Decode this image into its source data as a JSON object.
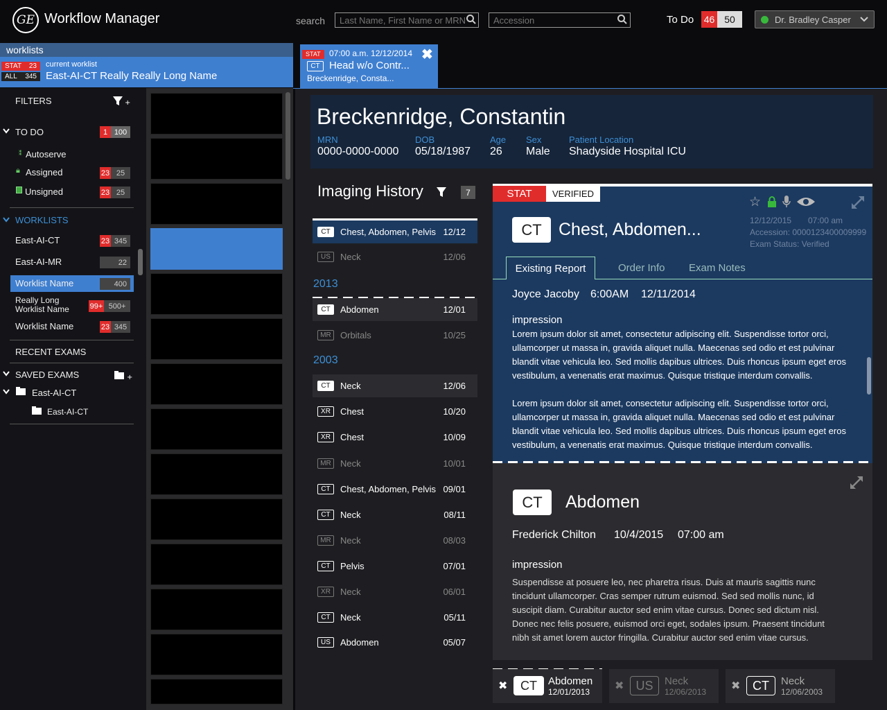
{
  "app": {
    "title": "Workflow Manager",
    "logo": "GE"
  },
  "search": {
    "label": "search",
    "name_placeholder": "Last Name, First Name or MRN",
    "accession_placeholder": "Accession"
  },
  "todo": {
    "label": "To Do",
    "stat": "46",
    "total": "50"
  },
  "user": {
    "name": "Dr. Bradley Casper",
    "status_color": "#38b93c"
  },
  "worklists": {
    "header": "worklists",
    "current_label": "current worklist",
    "current_name": "East-AI-CT Really Really Long Name",
    "stat_label": "STAT",
    "stat_count": "23",
    "all_label": "ALL",
    "all_count": "345"
  },
  "filters": {
    "title": "FILTERS",
    "todo": {
      "label": "TO DO",
      "stat": "1",
      "count": "100"
    },
    "todo_items": [
      {
        "label": "Autoserve",
        "icon": "autoserve-icon"
      },
      {
        "label": "Assigned",
        "stat": "23",
        "count": "25",
        "icon": "lock-icon"
      },
      {
        "label": "Unsigned",
        "stat": "23",
        "count": "25",
        "icon": "unsigned-icon"
      }
    ],
    "worklists_label": "WORKLISTS",
    "worklist_items": [
      {
        "label": "East-AI-CT",
        "stat": "23",
        "count": "345"
      },
      {
        "label": "East-AI-MR",
        "count": "22"
      },
      {
        "label": "Worklist Name",
        "count": "400"
      },
      {
        "label": "Really Long Worklist Name",
        "stat": "99+",
        "count": "500+"
      },
      {
        "label": "Worklist Name",
        "stat": "23",
        "count": "345"
      }
    ],
    "recent_label": "RECENT EXAMS",
    "saved_label": "SAVED EXAMS",
    "saved_folder": "East-AI-CT",
    "saved_sub": "East-AI-CT"
  },
  "tab": {
    "stat": "STAT",
    "time": "07:00 a.m. 12/12/2014",
    "modality": "CT",
    "title": "Head w/o Contr...",
    "patient": "Breckenridge, Consta..."
  },
  "patient": {
    "name": "Breckenridge, Constantin",
    "mrn_label": "MRN",
    "mrn": "0000-0000-0000",
    "dob_label": "DOB",
    "dob": "05/18/1987",
    "age_label": "Age",
    "age": "26",
    "sex_label": "Sex",
    "sex": "Male",
    "loc_label": "Patient Location",
    "loc": "Shadyside Hospital ICU"
  },
  "history": {
    "title": "Imaging History",
    "count": "7",
    "recent": [
      {
        "mod": "CT",
        "name": "Chest, Abdomen, Pelvis",
        "date": "12/12"
      },
      {
        "mod": "US",
        "name": "Neck",
        "date": "12/06"
      }
    ],
    "year1": "2013",
    "y2013": [
      {
        "mod": "CT",
        "name": "Abdomen",
        "date": "12/01"
      },
      {
        "mod": "MR",
        "name": "Orbitals",
        "date": "10/25"
      }
    ],
    "year2": "2003",
    "y2003": [
      {
        "mod": "CT",
        "name": "Neck",
        "date": "12/06"
      },
      {
        "mod": "XR",
        "name": "Chest",
        "date": "10/20"
      },
      {
        "mod": "XR",
        "name": "Chest",
        "date": "10/09"
      },
      {
        "mod": "MR",
        "name": "Neck",
        "date": "10/01"
      },
      {
        "mod": "CT",
        "name": "Chest, Abdomen, Pelvis",
        "date": "09/01"
      },
      {
        "mod": "CT",
        "name": "Neck",
        "date": "08/11"
      },
      {
        "mod": "MR",
        "name": "Neck",
        "date": "08/03"
      },
      {
        "mod": "CT",
        "name": "Pelvis",
        "date": "07/01"
      },
      {
        "mod": "XR",
        "name": "Neck",
        "date": "06/01"
      },
      {
        "mod": "CT",
        "name": "Neck",
        "date": "05/11"
      },
      {
        "mod": "US",
        "name": "Abdomen",
        "date": "05/07"
      }
    ]
  },
  "report1": {
    "stat": "STAT",
    "verified": "VERIFIED",
    "modality": "CT",
    "title": "Chest, Abdomen...",
    "date": "12/12/2015",
    "time": "07:00 am",
    "accession": "Accession: 0000123400009999",
    "status": "Exam Status: Verified",
    "tabs": [
      "Existing Report",
      "Order Info",
      "Exam Notes"
    ],
    "author": "Joyce Jacoby",
    "rtime": "6:00AM",
    "rdate": "12/11/2014",
    "impression": "impression",
    "p1": "Lorem ipsum dolor sit amet, consectetur adipiscing elit. Suspendisse tortor orci, ullamcorper ut massa in, gravida aliquet nulla. Maecenas sed odio et est pulvinar blandit vitae vehicula leo. Sed mollis dapibus ultrices. Duis rhoncus ipsum eget eros vestibulum, a venenatis erat maximus. Quisque tristique interdum convallis.",
    "p2": "Lorem ipsum dolor sit amet, consectetur adipiscing elit. Suspendisse tortor orci, ullamcorper ut massa in, gravida aliquet nulla. Maecenas sed odio et est pulvinar blandit vitae vehicula leo. Sed mollis dapibus ultrices. Duis rhoncus ipsum eget eros vestibulum, a venenatis erat maximus. Quisque tristique interdum convallis."
  },
  "report2": {
    "modality": "CT",
    "title": "Abdomen",
    "author": "Frederick Chilton",
    "rdate": "10/4/2015",
    "rtime": "07:00 am",
    "impression": "impression",
    "p1": "Suspendisse at posuere leo, nec pharetra risus. Duis at mauris sagittis nunc tincidunt ullamcorper. Cras semper rutrum euismod. Sed sed mollis nunc, id suscipit diam. Curabitur auctor sed enim vitae cursus. Donec sed dictum nisl. Donec nec felis posuere, euismod orci eget, sodales ipsum. Praesent tincidunt nibh sit amet lorem auctor fringilla. Curabitur auctor sed enim vitae cursus."
  },
  "compare": [
    {
      "mod": "CT",
      "name": "Abdomen",
      "date": "12/01/2013"
    },
    {
      "mod": "US",
      "name": "Neck",
      "date": "12/06/2013"
    },
    {
      "mod": "CT",
      "name": "Neck",
      "date": "12/06/2003"
    }
  ]
}
